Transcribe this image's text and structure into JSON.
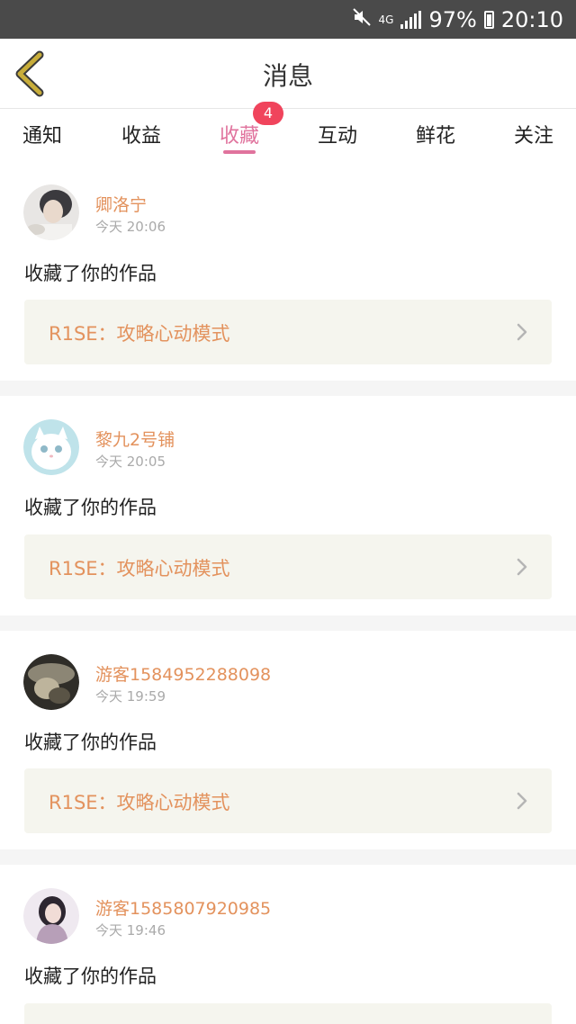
{
  "status_bar": {
    "network": "4G",
    "battery": "97%",
    "time": "20:10"
  },
  "header": {
    "title": "消息"
  },
  "tabs": [
    {
      "label": "通知"
    },
    {
      "label": "收益"
    },
    {
      "label": "收藏",
      "active": true,
      "badge": "4"
    },
    {
      "label": "互动"
    },
    {
      "label": "鲜花"
    },
    {
      "label": "关注"
    }
  ],
  "messages": [
    {
      "user": "卿洛宁",
      "time": "今天 20:06",
      "action": "收藏了你的作品",
      "work": "R1SE：攻略心动模式"
    },
    {
      "user": "黎九2号铺",
      "time": "今天 20:05",
      "action": "收藏了你的作品",
      "work": "R1SE：攻略心动模式"
    },
    {
      "user": "游客1584952288098",
      "time": "今天 19:59",
      "action": "收藏了你的作品",
      "work": "R1SE：攻略心动模式"
    },
    {
      "user": "游客1585807920985",
      "time": "今天 19:46",
      "action": "收藏了你的作品",
      "work": ""
    }
  ],
  "colors": {
    "accent": "#e0739d",
    "name": "#e3925d",
    "badge": "#f0445c",
    "back_arrow": "#c8ad3a"
  }
}
